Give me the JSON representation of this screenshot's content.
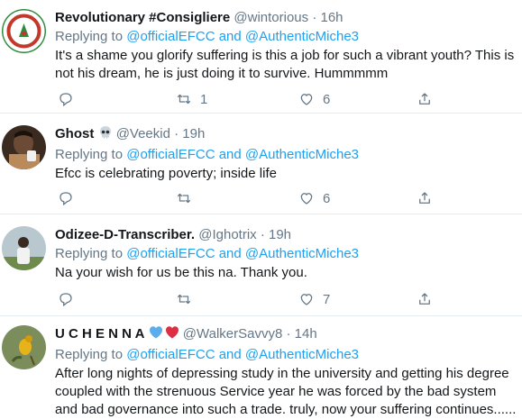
{
  "reply_prefix": "Replying to",
  "reply_to_1": "@officialEFCC",
  "reply_and": "and",
  "reply_to_2": "@AuthenticMiche3",
  "separator": "·",
  "tweets": [
    {
      "name": "Revolutionary #Consigliere",
      "handle": "@wintorious",
      "time": "16h",
      "text": "It's a shame you glorify suffering is this a job for such a vibrant youth? This is  not his dream, he is just doing it to survive. Hummmmm",
      "retweets": "1",
      "likes": "6",
      "avatar_colors": {
        "bg": "#ffffff",
        "ring": "#2e8b3c",
        "accent": "#c0392b"
      }
    },
    {
      "name": "Ghost",
      "name_emoji": "skull-emoji",
      "handle": "@Veekid",
      "time": "19h",
      "text": "Efcc is celebrating poverty; inside life",
      "retweets": "",
      "likes": "6",
      "avatar_colors": {
        "bg": "#3a2a20",
        "face": "#6b4a36"
      }
    },
    {
      "name": "Odizee-D-Transcriber.",
      "handle": "@Ighotrix",
      "time": "19h",
      "text": "Na your wish for us be this na. Thank you.",
      "retweets": "",
      "likes": "7",
      "avatar_colors": {
        "bg": "#b9c7cf",
        "ground": "#6f8b4c"
      }
    },
    {
      "name": "U C H E N N A",
      "name_emoji": "blue-heart-red-heart-emoji",
      "handle": "@WalkerSavvy8",
      "time": "14h",
      "text": "After long nights of depressing study in the university and getting his degree coupled with the strenuous Service year he was forced by the bad system and bad governance into such a trade. truly, now your suffering continues......",
      "retweets": "",
      "likes": "",
      "avatar_colors": {
        "bg": "#7a8d5a",
        "bird": "#e8b31a"
      }
    }
  ],
  "colors": {
    "link": "#1da1f2",
    "muted": "#657786",
    "divider": "#e6ecf0"
  }
}
